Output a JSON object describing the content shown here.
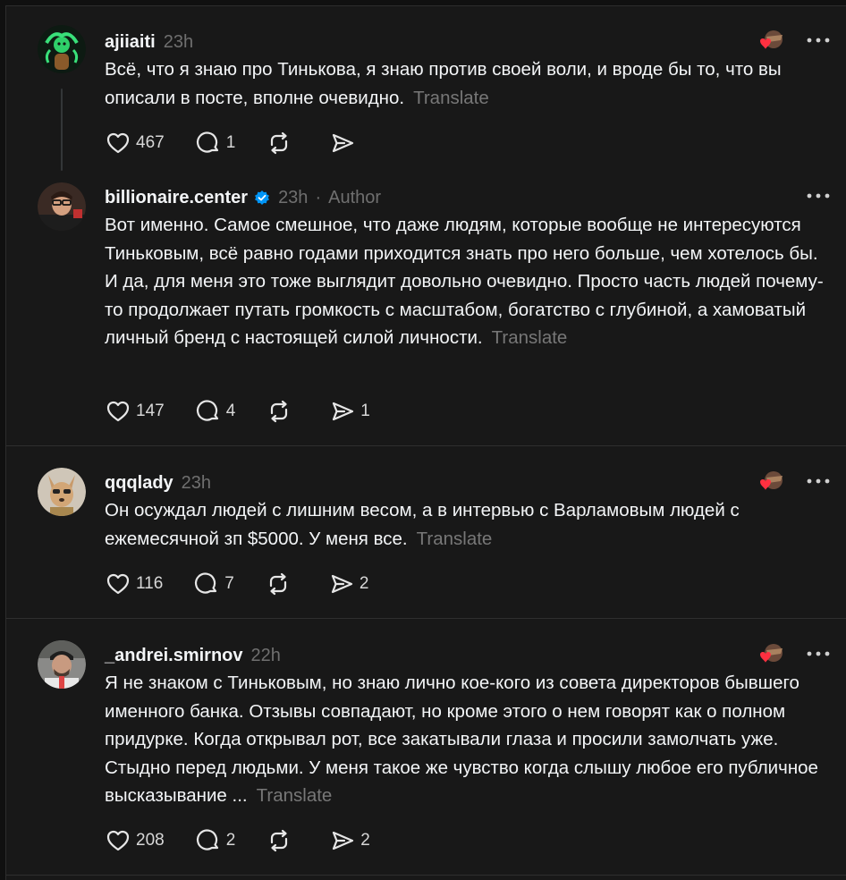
{
  "posts": [
    {
      "username": "ajiiaiti",
      "time": "23h",
      "paragraphs": [
        "Всё, что я знаю про Тинькова, я знаю против своей воли, и вроде бы то, что вы описали в посте, вполне очевидно."
      ],
      "translate": "Translate",
      "likes": "467",
      "replies": "1",
      "reposts": "",
      "shares": ""
    },
    {
      "username": "billionaire.center",
      "time": "23h",
      "separator": "·",
      "author_label": "Author",
      "paragraphs": [
        "Вот именно. Самое смешное, что даже людям, которые вообще не интересуются Тиньковым, всё равно годами приходится знать про него больше, чем хотелось бы.",
        "И да, для меня это тоже выглядит довольно очевидно. Просто часть людей почему-то продолжает путать громкость с масштабом, богатство с глубиной, а хамоватый личный бренд с настоящей силой личности."
      ],
      "translate": "Translate",
      "likes": "147",
      "replies": "4",
      "reposts": "",
      "shares": "1"
    },
    {
      "username": "qqqlady",
      "time": "23h",
      "paragraphs": [
        "Он осуждал людей с лишним весом, а в интервью с Варламовым людей с ежемесячной зп $5000. У меня все."
      ],
      "translate": "Translate",
      "likes": "116",
      "replies": "7",
      "reposts": "",
      "shares": "2"
    },
    {
      "username": "_andrei.smirnov",
      "time": "22h",
      "paragraphs": [
        "Я не знаком с Тиньковым, но знаю лично кое-кого из совета директоров бывшего именного банка. Отзывы совпадают, но кроме этого о нем говорят как о полном придурке. Когда открывал рот, все закатывали глаза и просили замолчать уже. Стыдно перед людьми. У меня такое же чувство когда слышу любое его публичное высказывание ..."
      ],
      "translate": "Translate",
      "likes": "208",
      "replies": "2",
      "reposts": "",
      "shares": "2"
    }
  ],
  "icons": {
    "like": "heart-icon",
    "reply": "comment-icon",
    "repost": "repost-icon",
    "share": "send-icon",
    "more": "more-icon",
    "verified": "verified-badge-icon",
    "liked_by_author": "liked-by-author-icon"
  },
  "colors": {
    "background": "#181818",
    "text": "#f3f5f7",
    "muted": "#777777",
    "verified": "#0095f6",
    "heart": "#ff3040"
  }
}
